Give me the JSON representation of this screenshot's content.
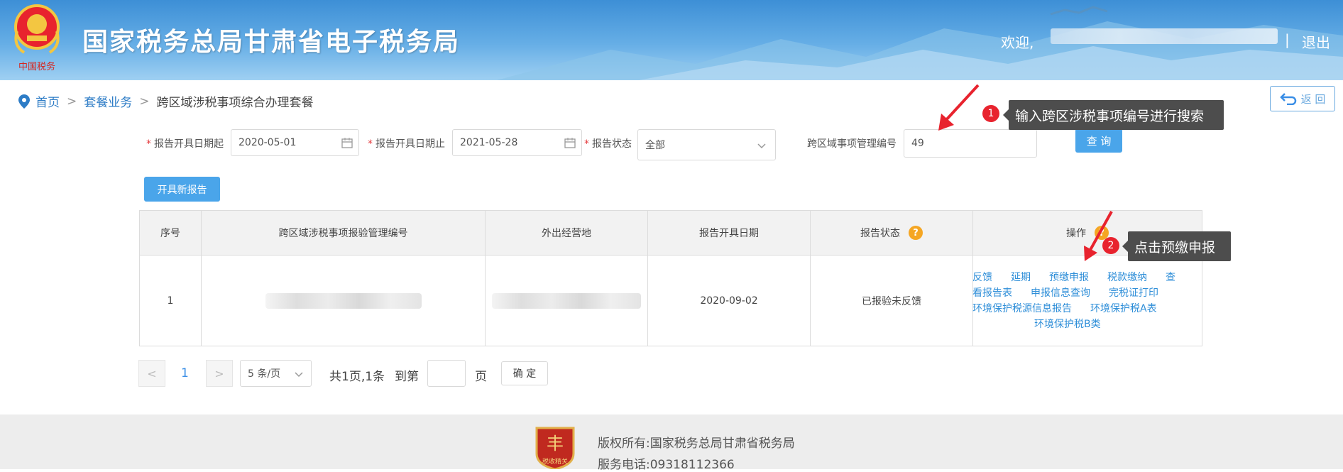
{
  "header": {
    "emblem_text": "中国税务",
    "title": "国家税务总局甘肃省电子税务局",
    "welcome": "欢迎,",
    "separator": "|",
    "logout": "退出"
  },
  "breadcrumb": {
    "home": "首页",
    "sep1": ">",
    "package": "套餐业务",
    "sep2": ">",
    "current": "跨区域涉税事项综合办理套餐",
    "back": "返 回"
  },
  "filters": {
    "start_label": "报告开具日期起",
    "start_value": "2020-05-01",
    "end_label": "报告开具日期止",
    "end_value": "2021-05-28",
    "status_label": "报告状态",
    "status_value": "全部",
    "code_label": "跨区域事项管理编号",
    "code_value": "49",
    "query_button": "查 询",
    "new_report_button": "开具新报告"
  },
  "tips": {
    "step1_num": "1",
    "step1_text": "输入跨区涉税事项编号进行搜索",
    "step2_num": "2",
    "step2_text": "点击预缴申报"
  },
  "table": {
    "headers": [
      "序号",
      "跨区域涉税事项报验管理编号",
      "外出经营地",
      "报告开具日期",
      "报告状态",
      "操作"
    ],
    "help_mark": "?",
    "rows": [
      {
        "index": "1",
        "date": "2020-09-02",
        "status": "已报验未反馈",
        "ops_line1": [
          "反馈",
          "延期",
          "预缴申报",
          "税款缴纳",
          "查"
        ],
        "ops_line2": [
          "看报告表",
          "申报信息查询",
          "完税证打印"
        ],
        "ops_line3": [
          "环境保护税源信息报告",
          "环境保护税A表"
        ],
        "ops_line4": [
          "环境保护税B类"
        ]
      }
    ]
  },
  "pager": {
    "prev": "<",
    "page": "1",
    "next": ">",
    "page_size": "5 条/页",
    "summary": "共1页,1条",
    "goto_label": "到第",
    "page_unit": "页",
    "confirm": "确 定"
  },
  "footer": {
    "logo_text": "税收精关",
    "copyright": "版权所有:国家税务总局甘肃省税务局",
    "phone": "服务电话:09318112366"
  },
  "colors": {
    "primary": "#4aa5ea",
    "link": "#2e8ed8",
    "required": "#e4393c",
    "step_badge": "#e8232e",
    "tooltip": "#4d4d4d",
    "help": "#f5a623"
  }
}
